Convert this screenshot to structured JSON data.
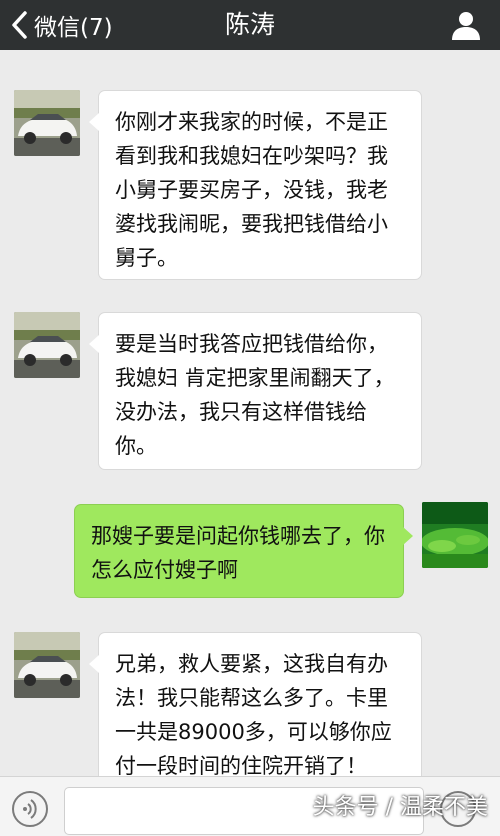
{
  "header": {
    "back_label": "微信(7)",
    "title": "陈涛"
  },
  "messages": [
    {
      "side": "left",
      "avatar": "car-photo",
      "text": "你刚才来我家的时候，不是正看到我和我媳妇在吵架吗？我小舅子要买房子，没钱，我老婆找我闹昵，要我把钱借给小舅子。"
    },
    {
      "side": "left",
      "avatar": "car-photo",
      "text": "要是当时我答应把钱借给你，我媳妇 肯定把家里闹翻天了，没办法，我只有这样借钱给你。"
    },
    {
      "side": "right",
      "avatar": "grass-photo",
      "text": "那嫂子要是问起你钱哪去了，你怎么应付嫂子啊"
    },
    {
      "side": "left",
      "avatar": "car-photo",
      "text": "兄弟，救人要紧，这我自有办法！我只能帮这么多了。卡里一共是89000多，可以够你应付一段时间的住院开销了！"
    }
  ],
  "input": {
    "value": ""
  },
  "watermark": "头条号 / 温柔不美",
  "colors": {
    "header_bg": "#2e3132",
    "chat_bg": "#ebebeb",
    "sent_bubble": "#9fe85e",
    "received_bubble": "#ffffff"
  }
}
